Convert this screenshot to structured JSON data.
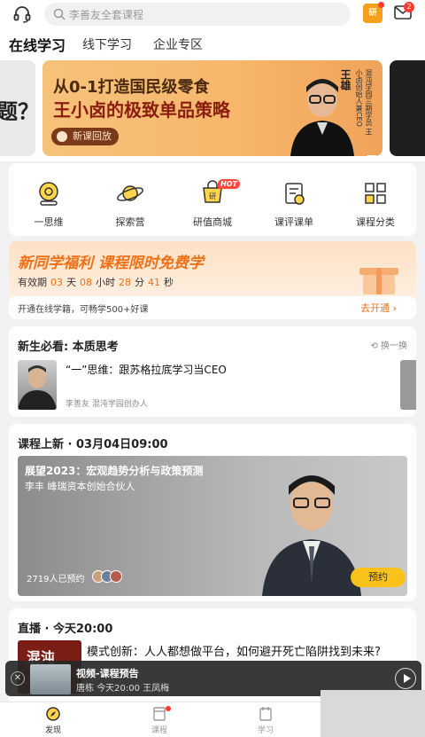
{
  "search": {
    "placeholder": "李善友全套课程"
  },
  "header": {
    "study_icon_text": "研",
    "mail_badge": "2"
  },
  "tabs": [
    {
      "label": "在线学习",
      "active": true
    },
    {
      "label": "线下学习",
      "active": false
    },
    {
      "label": "企业专区",
      "active": false
    }
  ],
  "banner": {
    "left_peek_text": "题？",
    "line1": "从0-1打造国民级零食",
    "line2": "王小卤的极致单品策略",
    "button_label": "新课回放",
    "speaker_name": "王雄",
    "speaker_desc": "混沌学园三期学员 王小卤创始人兼CEO"
  },
  "quick_icons": [
    {
      "label": "一思维",
      "icon": "lamp-icon"
    },
    {
      "label": "探索营",
      "icon": "planet-icon"
    },
    {
      "label": "研值商城",
      "icon": "cart-icon",
      "badge": "HOT"
    },
    {
      "label": "课评课单",
      "icon": "review-icon"
    },
    {
      "label": "课程分类",
      "icon": "grid-icon"
    }
  ],
  "promo": {
    "title": "新同学福利 课程限时免费学",
    "countdown": {
      "prefix": "有效期",
      "days": "03",
      "days_unit": "天",
      "hours": "08",
      "hours_unit": "小时",
      "minutes": "28",
      "minutes_unit": "分",
      "seconds": "41",
      "seconds_unit": "秒"
    },
    "text": "开通在线学籍，可畅学500+好课",
    "link": "去开通 ›"
  },
  "think": {
    "title": "新生必看: 本质思考",
    "refresh": "换一换",
    "question": "“一”思维：跟苏格拉底学习当CEO",
    "author": "李善友 混沌学园创办人"
  },
  "course": {
    "title": "课程上新 · 03月04日09:00",
    "hero_title": "展望2023：宏观趋势分析与政策预测",
    "hero_sub": "李丰  峰瑞资本创始合伙人",
    "count": "2719人已预约",
    "button": "预约"
  },
  "live": {
    "title": "直播 · 今天20:00",
    "thumb_text": "混沌",
    "item_title": "模式创新：人人都想做平台，如何避开死亡陷阱找到未来?"
  },
  "mini_player": {
    "title": "视频-课程预告",
    "subtitle_prefix": "唐栋",
    "subtitle": "今天20:00  王凤梅"
  },
  "bottom_nav": [
    {
      "label": "发现",
      "active": true
    },
    {
      "label": "课程",
      "active": false
    },
    {
      "label": "学习",
      "active": false
    }
  ],
  "colors": {
    "accent": "#f07018",
    "primary_button": "#f9c21a",
    "badge_red": "#ff3b30"
  }
}
